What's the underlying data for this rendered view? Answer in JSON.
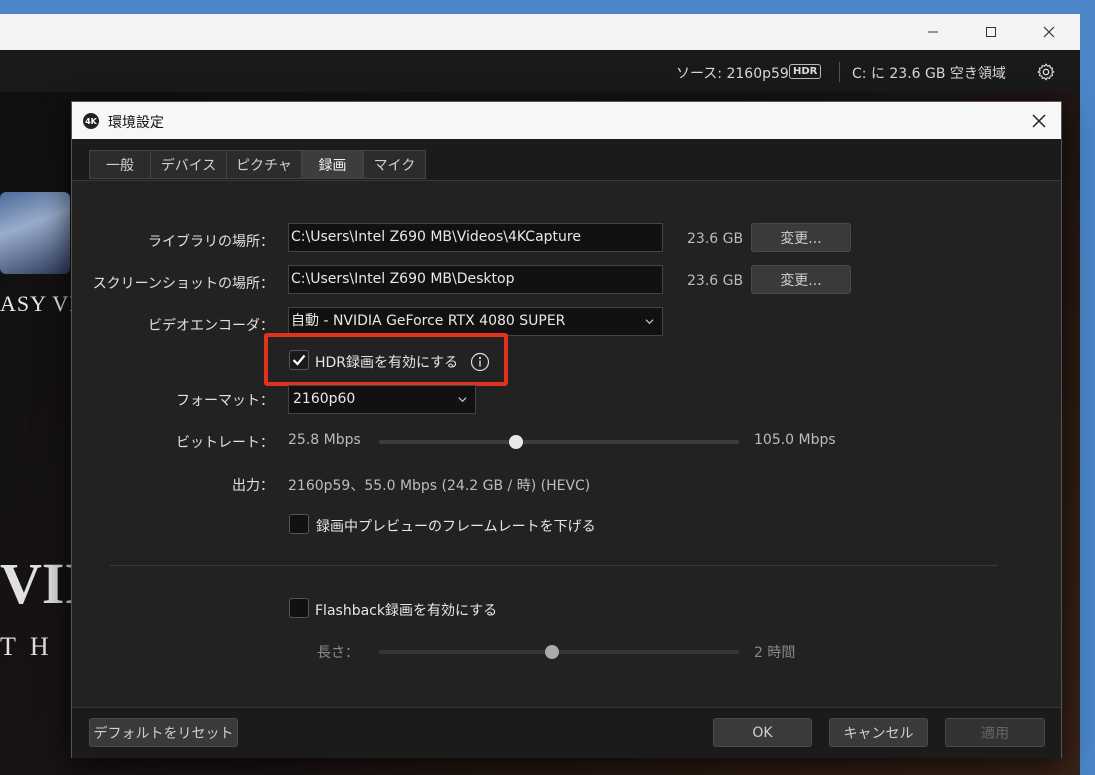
{
  "topbar": {
    "source_label": "ソース: 2160p59",
    "hdr_badge": "HDR",
    "free_space": "C: に 23.6 GB 空き領域"
  },
  "background": {
    "game_title_fragment": "ASY VII",
    "roman_fragment": "VII",
    "subtitle_fragment": "T H"
  },
  "dialog": {
    "title": "環境設定",
    "app_logo": "4K",
    "tabs": [
      {
        "label": "一般"
      },
      {
        "label": "デバイス"
      },
      {
        "label": "ピクチャ"
      },
      {
        "label": "録画"
      },
      {
        "label": "マイク"
      }
    ],
    "active_tab": "録画",
    "library": {
      "label": "ライブラリの場所：",
      "path": "C:\\Users\\Intel Z690 MB\\Videos\\4KCapture",
      "size": "23.6 GB",
      "button": "変更..."
    },
    "screenshot": {
      "label": "スクリーンショットの場所：",
      "path": "C:\\Users\\Intel Z690 MB\\Desktop",
      "size": "23.6 GB",
      "button": "変更..."
    },
    "encoder": {
      "label": "ビデオエンコーダ：",
      "value": "自動 - NVIDIA GeForce RTX 4080 SUPER"
    },
    "hdr": {
      "label": "HDR録画を有効にする",
      "checked": true
    },
    "format": {
      "label": "フォーマット：",
      "value": "2160p60"
    },
    "bitrate": {
      "label": "ビットレート：",
      "min": "25.8 Mbps",
      "max": "105.0 Mbps",
      "level": 0.38
    },
    "output": {
      "label": "出力：",
      "value": "2160p59、55.0 Mbps (24.2 GB / 時) (HEVC)"
    },
    "lower_preview": {
      "label": "録画中プレビューのフレームレートを下げる",
      "checked": false
    },
    "flashback": {
      "label": "Flashback録画を有効にする",
      "checked": false
    },
    "length": {
      "label": "長さ：",
      "value": "2 時間",
      "level": 0.48
    },
    "footer": {
      "reset": "デフォルトをリセット",
      "ok": "OK",
      "cancel": "キャンセル",
      "apply": "適用"
    }
  }
}
